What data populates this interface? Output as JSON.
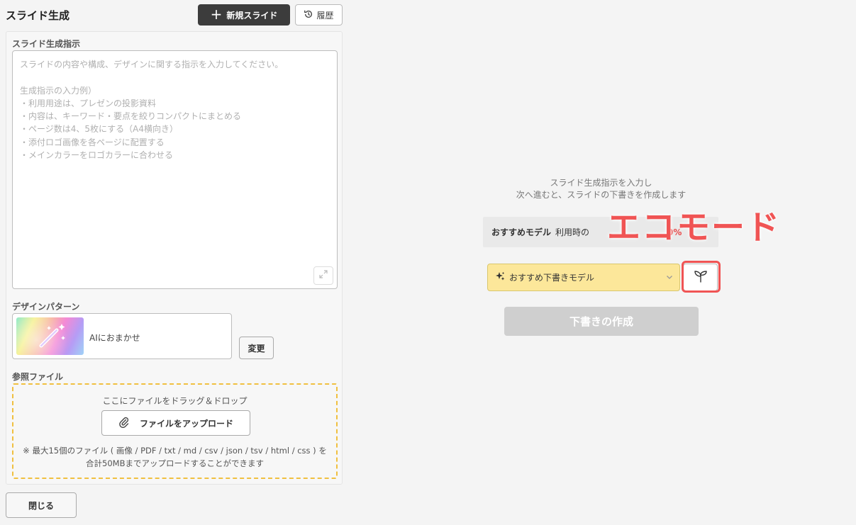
{
  "header": {
    "title": "スライド生成",
    "new_slide_label": "新規スライド",
    "history_label": "履歴"
  },
  "instruction_section": {
    "label": "スライド生成指示",
    "placeholder_lines": [
      "スライドの内容や構成、デザインに関する指示を入力してください。",
      "",
      "生成指示の入力例）",
      "・利用用途は、プレゼンの投影資料",
      "・内容は、キーワード・要点を絞りコンパクトにまとめる",
      "・ページ数は4、5枚にする（A4横向き）",
      "・添付ロゴ画像を各ページに配置する",
      "・メインカラーをロゴカラーに合わせる"
    ]
  },
  "design_section": {
    "label": "デザインパターン",
    "selected": "AIにおまかせ",
    "change_label": "変更"
  },
  "reference_section": {
    "label": "参照ファイル",
    "drop_text": "ここにファイルをドラッグ＆ドロップ",
    "upload_label": "ファイルをアップロード",
    "note_line1": "※ 最大15個のファイル ( 画像 / PDF / txt / md / csv / json / tsv / html / css ) を",
    "note_line2": "合計50MBまでアップロードすることができます"
  },
  "close_label": "閉じる",
  "right_panel": {
    "instruction_line1": "スライド生成指示を入力し",
    "instruction_line2": "次へ進むと、スライドの下書きを作成します",
    "recommend_bold": "おすすめモデル",
    "recommend_text": "利用時の",
    "recommend_highlight": "0%",
    "model_select_value": "おすすめ下書きモデル",
    "create_draft_label": "下書きの作成"
  },
  "annotation": {
    "eco_mode": "エコモード"
  },
  "colors": {
    "accent_red": "#f05454",
    "model_select_bg": "#fce79a",
    "dropzone_border": "#f0c040",
    "dark_button": "#3c3c3c"
  },
  "icons": {
    "new_slide": "plus-icon",
    "history": "history-icon",
    "expand": "expand-icon",
    "upload": "paperclip-icon",
    "model": "sparkle-icon",
    "select": "chevron-down-icon",
    "eco": "sprout-icon"
  }
}
